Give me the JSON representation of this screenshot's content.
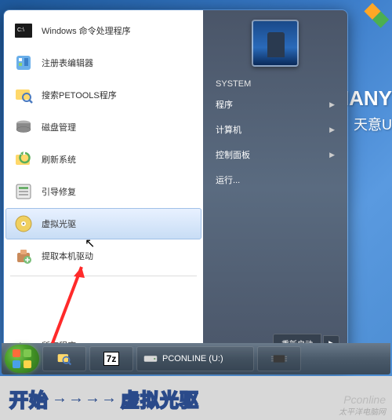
{
  "brand": {
    "title": "TIANY",
    "subtitle": "天意U"
  },
  "start_menu": {
    "left_items": [
      {
        "label": "Windows 命令处理程序",
        "icon": "cmd"
      },
      {
        "label": "注册表编辑器",
        "icon": "regedit"
      },
      {
        "label": "搜索PETOOLS程序",
        "icon": "search"
      },
      {
        "label": "磁盘管理",
        "icon": "diskmgmt"
      },
      {
        "label": "刷新系统",
        "icon": "refresh"
      },
      {
        "label": "引导修复",
        "icon": "bootrepair"
      },
      {
        "label": "虚拟光驱",
        "icon": "virtualcd",
        "highlighted": true
      },
      {
        "label": "提取本机驱动",
        "icon": "extractdrv"
      }
    ],
    "all_programs": "所有程序",
    "right": {
      "user": "SYSTEM",
      "items": [
        {
          "label": "程序",
          "submenu": true
        },
        {
          "label": "计算机",
          "submenu": true
        },
        {
          "label": "控制面板",
          "submenu": true
        },
        {
          "label": "运行...",
          "submenu": false
        }
      ],
      "power_label": "重新启动"
    }
  },
  "taskbar": {
    "items": [
      {
        "name": "search-util",
        "label": ""
      },
      {
        "name": "7z",
        "label": "7z"
      },
      {
        "name": "drive",
        "label": "PCONLINE (U:)"
      },
      {
        "name": "chip",
        "label": ""
      }
    ]
  },
  "caption": {
    "text_a": "开始",
    "text_b": "虚拟光驱"
  },
  "watermark": {
    "top": "Pconline",
    "bottom": "太平洋电脑网"
  }
}
